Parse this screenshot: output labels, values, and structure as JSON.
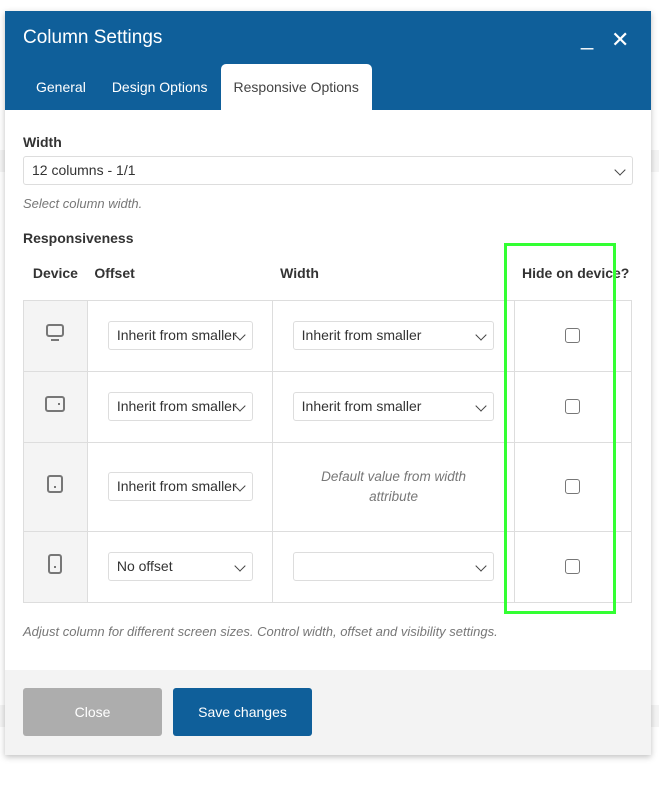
{
  "dialog": {
    "title": "Column Settings",
    "minimize_icon": "minimize-icon",
    "close_icon": "close-icon",
    "tabs": [
      {
        "label": "General",
        "active": false
      },
      {
        "label": "Design Options",
        "active": false
      },
      {
        "label": "Responsive Options",
        "active": true
      }
    ]
  },
  "width_field": {
    "label": "Width",
    "value": "12 columns - 1/1",
    "help": "Select column width."
  },
  "responsiveness": {
    "label": "Responsiveness",
    "headers": {
      "device": "Device",
      "offset": "Offset",
      "width": "Width",
      "hide": "Hide on device?"
    },
    "rows": [
      {
        "device_icon": "desktop-icon",
        "offset": "Inherit from smaller",
        "width": "Inherit from smaller",
        "hidden": false
      },
      {
        "device_icon": "tablet-landscape-icon",
        "offset": "Inherit from smaller",
        "width": "Inherit from smaller",
        "hidden": false
      },
      {
        "device_icon": "tablet-portrait-icon",
        "offset": "Inherit from smaller",
        "width_note": "Default value from width attribute",
        "hidden": false
      },
      {
        "device_icon": "mobile-icon",
        "offset": "No offset",
        "width": "",
        "hidden": false
      }
    ],
    "help": "Adjust column for different screen sizes. Control width, offset and visibility settings."
  },
  "footer": {
    "close_label": "Close",
    "save_label": "Save changes"
  },
  "colors": {
    "header": "#0f5f9a",
    "save": "#0f5f9a",
    "close": "#adadad",
    "highlight": "#33ff33"
  }
}
